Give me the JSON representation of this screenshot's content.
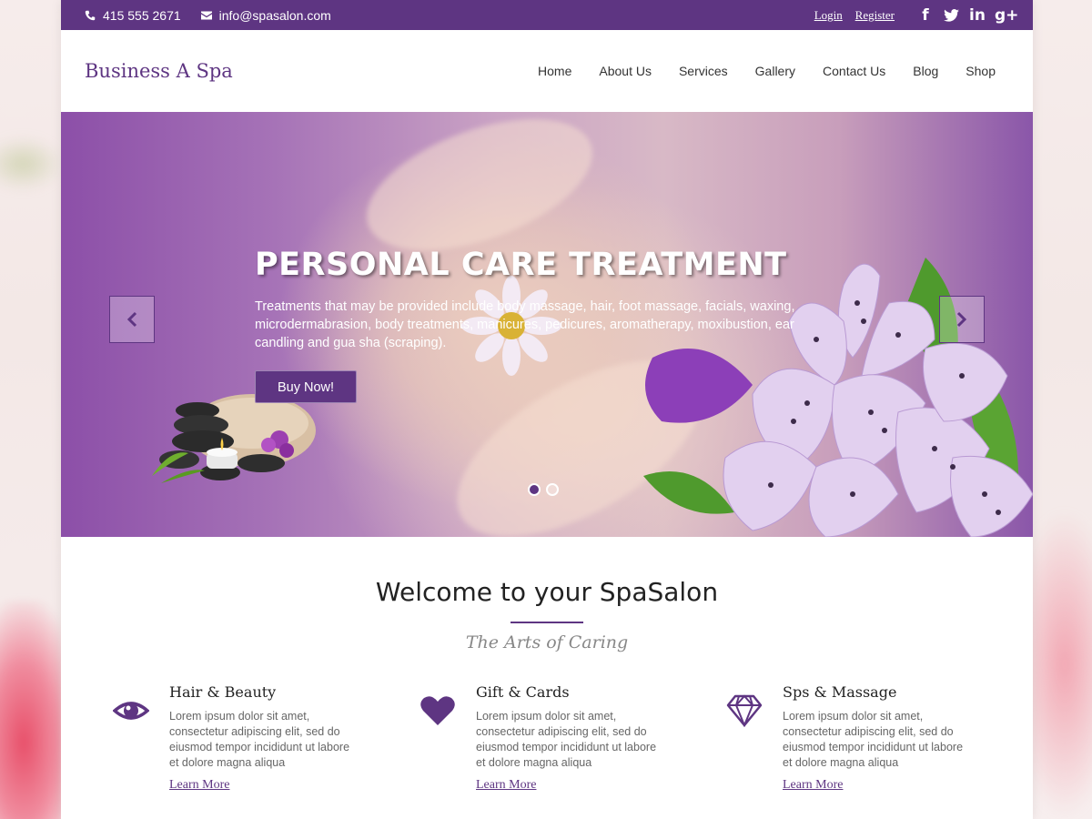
{
  "colors": {
    "accent": "#5e3582",
    "topbar": "#5e3582"
  },
  "topbar": {
    "phone": "415 555 2671",
    "email": "info@spasalon.com",
    "login": "Login",
    "register": "Register",
    "social": [
      "facebook-icon",
      "twitter-icon",
      "linkedin-icon",
      "google-plus-icon"
    ]
  },
  "header": {
    "logo": "Business A Spa",
    "nav": [
      "Home",
      "About Us",
      "Services",
      "Gallery",
      "Contact Us",
      "Blog",
      "Shop"
    ]
  },
  "hero": {
    "title": "PERSONAL CARE TREATMENT",
    "text": "Treatments that may be provided include body massage, hair, foot massage, facials, waxing, microdermabrasion, body treatments, manicures, pedicures, aromatherapy, moxibustion, ear candling and gua sha (scraping).",
    "button": "Buy Now!",
    "slides_total": 2,
    "active_slide": 1
  },
  "welcome": {
    "title": "Welcome to your SpaSalon",
    "tagline": "The Arts of Caring"
  },
  "features": [
    {
      "icon": "eye-icon",
      "title": "Hair & Beauty",
      "text": "Lorem ipsum dolor sit amet, consectetur adipiscing elit, sed do eiusmod tempor incididunt ut labore et dolore magna aliqua",
      "link": "Learn More"
    },
    {
      "icon": "heart-icon",
      "title": "Gift & Cards",
      "text": "Lorem ipsum dolor sit amet, consectetur adipiscing elit, sed do eiusmod tempor incididunt ut labore et dolore magna aliqua",
      "link": "Learn More"
    },
    {
      "icon": "diamond-icon",
      "title": "Sps & Massage",
      "text": "Lorem ipsum dolor sit amet, consectetur adipiscing elit, sed do eiusmod tempor incididunt ut labore et dolore magna aliqua",
      "link": "Learn More"
    }
  ]
}
